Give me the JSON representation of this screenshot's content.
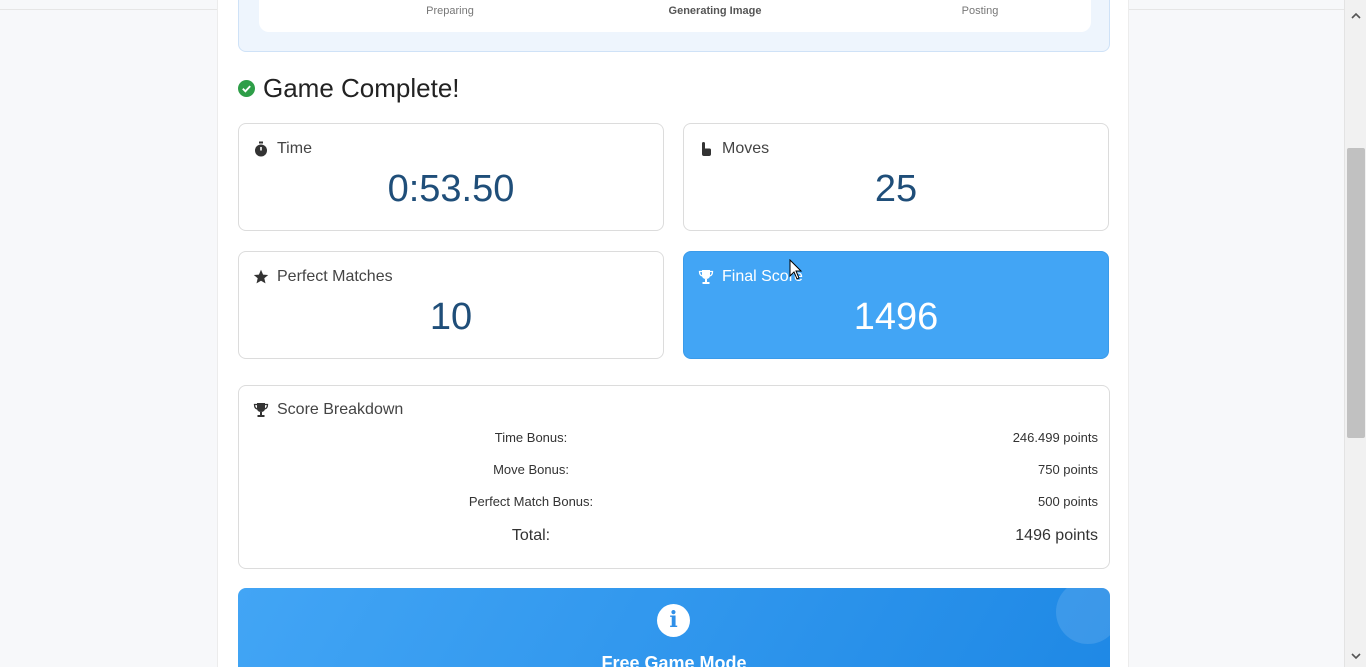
{
  "progress": {
    "steps": [
      {
        "label": "Preparing"
      },
      {
        "label": "Generating Image"
      },
      {
        "label": "Posting"
      }
    ]
  },
  "result": {
    "title": "Game Complete!",
    "stats": {
      "time": {
        "label": "Time",
        "value": "0:53.50",
        "icon": "stopwatch-icon"
      },
      "moves": {
        "label": "Moves",
        "value": "25",
        "icon": "hand-pointer-icon"
      },
      "perfect": {
        "label": "Perfect Matches",
        "value": "10",
        "icon": "star-icon"
      },
      "final": {
        "label": "Final Score",
        "value": "1496",
        "icon": "trophy-icon"
      }
    }
  },
  "breakdown": {
    "title": "Score Breakdown",
    "rows": [
      {
        "label": "Time Bonus:",
        "value": "246.499 points"
      },
      {
        "label": "Move Bonus:",
        "value": "750 points"
      },
      {
        "label": "Perfect Match Bonus:",
        "value": "500 points"
      }
    ],
    "total": {
      "label": "Total:",
      "value": "1496 points"
    }
  },
  "free_mode": {
    "title": "Free Game Mode",
    "icon": "info-icon"
  },
  "colors": {
    "accent_blue": "#42a5f5",
    "value_text": "#1f4e79",
    "success_green": "#2e9e48"
  }
}
